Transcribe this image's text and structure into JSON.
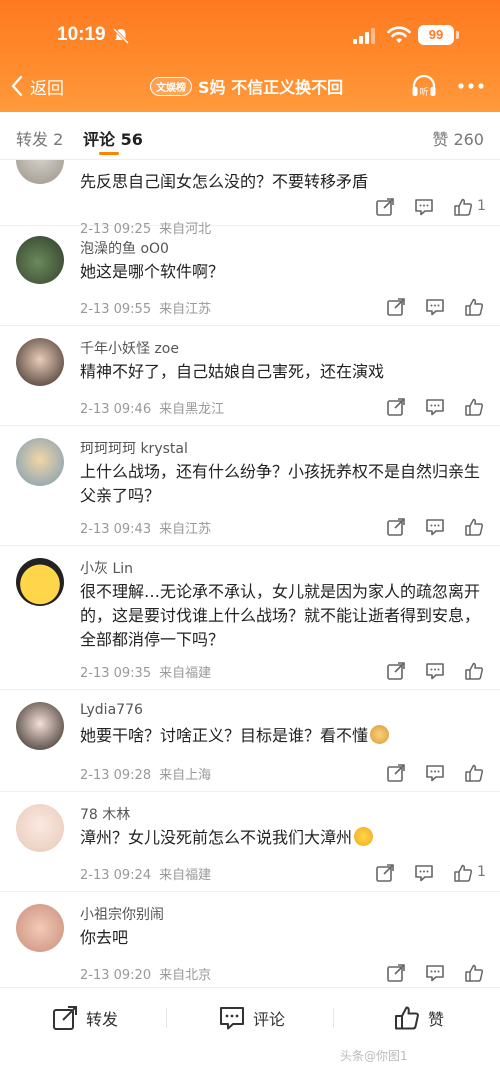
{
  "status": {
    "time": "10:19",
    "battery": "99"
  },
  "nav": {
    "back_label": "返回",
    "badge": "文娱榜",
    "title": "S妈 不信正义换不回",
    "listen_label": "听"
  },
  "tabs": {
    "repost": "转发 2",
    "comment": "评论 56",
    "like": "赞 260"
  },
  "comments": [
    {
      "name": "",
      "text": "先反思自己闺女怎么没的？不要转移矛盾",
      "time": "2-13 09:25",
      "location": "来自河北",
      "likes": "1"
    },
    {
      "name": "泡澡的鱼 oO0",
      "text": "她这是哪个软件啊？",
      "time": "2-13 09:55",
      "location": "来自江苏",
      "likes": ""
    },
    {
      "name": "千年小妖怪 zoe",
      "text": "精神不好了，自己姑娘自己害死，还在演戏",
      "time": "2-13 09:46",
      "location": "来自黑龙江",
      "likes": ""
    },
    {
      "name": "珂珂珂珂 krystal",
      "text": "上什么战场，还有什么纷争？小孩抚养权不是自然归亲生父亲了吗？",
      "time": "2-13 09:43",
      "location": "来自江苏",
      "likes": ""
    },
    {
      "name": "小灰 Lin",
      "text": "很不理解…无论承不承认，女儿就是因为家人的疏忽离开的，这是要讨伐谁上什么战场？就不能让逝者得到安息，全部都消停一下吗？",
      "time": "2-13 09:35",
      "location": "来自福建",
      "likes": ""
    },
    {
      "name": "Lydia776",
      "text": "她要干啥？讨啥正义？目标是谁？看不懂",
      "time": "2-13 09:28",
      "location": "来自上海",
      "likes": ""
    },
    {
      "name": "78 木林",
      "text": "漳州？女儿没死前怎么不说我们大漳州",
      "time": "2-13 09:24",
      "location": "来自福建",
      "likes": "1"
    },
    {
      "name": "小祖宗你别闹",
      "text": "你去吧",
      "time": "2-13 09:20",
      "location": "来自北京",
      "likes": ""
    }
  ],
  "bottom": {
    "repost": "转发",
    "comment": "评论",
    "like": "赞"
  },
  "watermark": "头条@你图1",
  "colors": {
    "header": "#ff8a2c",
    "accent": "#ff8200"
  }
}
